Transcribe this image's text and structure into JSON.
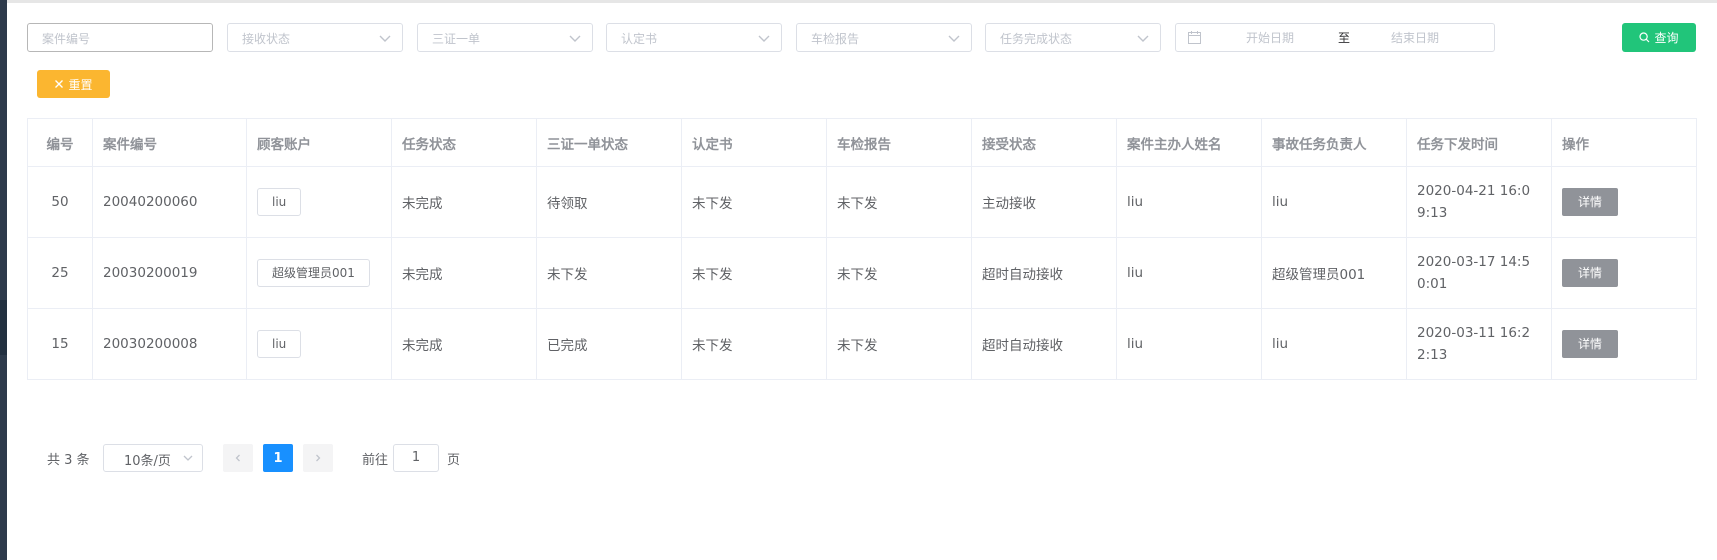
{
  "filters": {
    "case_no_placeholder": "案件编号",
    "receive_status_placeholder": "接收状态",
    "three_cert_placeholder": "三证一单",
    "certificate_placeholder": "认定书",
    "inspection_placeholder": "车检报告",
    "task_status_placeholder": "任务完成状态",
    "start_date_placeholder": "开始日期",
    "date_separator": "至",
    "end_date_placeholder": "结束日期",
    "query_label": "查询",
    "reset_label": "重置"
  },
  "table": {
    "headers": [
      "编号",
      "案件编号",
      "顾客账户",
      "任务状态",
      "三证一单状态",
      "认定书",
      "车检报告",
      "接受状态",
      "案件主办人姓名",
      "事故任务负责人",
      "任务下发时间",
      "操作"
    ],
    "rows": [
      {
        "id": "50",
        "case_no": "20040200060",
        "account": "liu",
        "task_status": "未完成",
        "three_cert_status": "待领取",
        "certificate": "未下发",
        "inspection": "未下发",
        "accept_status": "主动接收",
        "host_name": "liu",
        "owner": "liu",
        "issue_time": "2020-04-21 16:09:13",
        "action": "详情"
      },
      {
        "id": "25",
        "case_no": "20030200019",
        "account": "超级管理员001",
        "task_status": "未完成",
        "three_cert_status": "未下发",
        "certificate": "未下发",
        "inspection": "未下发",
        "accept_status": "超时自动接收",
        "host_name": "liu",
        "owner": "超级管理员001",
        "issue_time": "2020-03-17 14:50:01",
        "action": "详情"
      },
      {
        "id": "15",
        "case_no": "20030200008",
        "account": "liu",
        "task_status": "未完成",
        "three_cert_status": "已完成",
        "certificate": "未下发",
        "inspection": "未下发",
        "accept_status": "超时自动接收",
        "host_name": "liu",
        "owner": "liu",
        "issue_time": "2020-03-11 16:22:13",
        "action": "详情"
      }
    ]
  },
  "pagination": {
    "total_text": "共 3 条",
    "page_size": "10条/页",
    "current_page": "1",
    "goto_label": "前往",
    "goto_value": "1",
    "page_word": "页"
  },
  "colors": {
    "query_button": "#21c57a",
    "reset_button": "#fbb630",
    "active_page": "#1890ff",
    "detail_button": "#909399"
  },
  "icons": {
    "query": "search-icon",
    "reset": "close-icon",
    "date": "calendar-icon",
    "select": "chevron-down-icon",
    "prev": "chevron-left-icon",
    "next": "chevron-right-icon"
  }
}
